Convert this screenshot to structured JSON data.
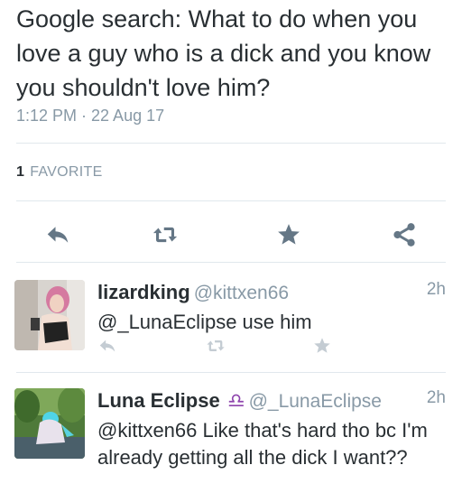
{
  "tweet": {
    "text": "Google search: What to do when you love a guy who is a dick and you know you shouldn't love him?",
    "timestamp": "1:12 PM · 22 Aug 17",
    "favorite_count": "1",
    "favorite_label": "FAVORITE"
  },
  "actions": {
    "icons": [
      "reply-icon",
      "retweet-icon",
      "favorite-icon",
      "share-icon"
    ]
  },
  "replies": [
    {
      "name": "lizardking",
      "handle": "@kittxen66",
      "time": "2h",
      "text": "@_LunaEclipse use him",
      "avatar": "avatar-photo"
    },
    {
      "name": "Luna Eclipse",
      "badge_icon": "libra-icon",
      "handle": "@_LunaEclipse",
      "time": "2h",
      "text": "@kittxen66 Like that's hard tho bc I'm already getting all the dick I want??",
      "avatar": "avatar-photo"
    }
  ],
  "colors": {
    "text": "#292f33",
    "muted": "#8899a6",
    "icon": "#657786",
    "divider": "#e1e8ed",
    "badge": "#8e44ad"
  }
}
